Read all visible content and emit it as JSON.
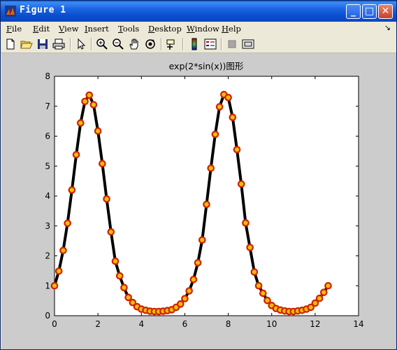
{
  "window": {
    "title": "Figure 1",
    "controls": {
      "minimize": "_",
      "maximize": "□",
      "close": "✕"
    }
  },
  "menubar": {
    "items": [
      {
        "label": "File",
        "accel": "F",
        "rest": "ile"
      },
      {
        "label": "Edit",
        "accel": "E",
        "rest": "dit"
      },
      {
        "label": "View",
        "accel": "V",
        "rest": "iew"
      },
      {
        "label": "Insert",
        "accel": "I",
        "rest": "nsert"
      },
      {
        "label": "Tools",
        "accel": "T",
        "rest": "ools"
      },
      {
        "label": "Desktop",
        "accel": "D",
        "rest": "esktop"
      },
      {
        "label": "Window",
        "accel": "W",
        "rest": "indow"
      },
      {
        "label": "Help",
        "accel": "H",
        "rest": "elp"
      }
    ],
    "overflow_arrow": "↘"
  },
  "toolbar": {
    "icons": [
      "new-figure-icon",
      "open-file-icon",
      "save-icon",
      "print-icon",
      "select-arrow-icon",
      "zoom-in-icon",
      "zoom-out-icon",
      "pan-hand-icon",
      "rotate-3d-icon",
      "data-cursor-icon",
      "colorbar-icon",
      "legend-icon",
      "hide-plot-tools-icon",
      "show-plot-tools-icon"
    ]
  },
  "chart_data": {
    "type": "line",
    "title": "exp(2*sin(x))图形",
    "xlabel": "",
    "ylabel": "",
    "xlim": [
      0,
      14
    ],
    "ylim": [
      0,
      8
    ],
    "xticks": [
      "0",
      "2",
      "4",
      "6",
      "8",
      "10",
      "12",
      "14"
    ],
    "yticks": [
      "0",
      "1",
      "2",
      "3",
      "4",
      "5",
      "6",
      "7",
      "8"
    ],
    "grid": false,
    "series": [
      {
        "line_color": "#000000",
        "marker_edge_color": "#d02000",
        "marker_face_color": "#f0c000",
        "marker": "circle",
        "x": [
          0,
          0.2,
          0.4,
          0.6,
          0.8,
          1.0,
          1.2,
          1.4,
          1.6,
          1.8,
          2.0,
          2.2,
          2.4,
          2.6,
          2.8,
          3.0,
          3.2,
          3.4,
          3.6,
          3.8,
          4.0,
          4.2,
          4.4,
          4.6,
          4.8,
          5.0,
          5.2,
          5.4,
          5.6,
          5.8,
          6.0,
          6.2,
          6.4,
          6.6,
          6.8,
          7.0,
          7.2,
          7.4,
          7.6,
          7.8,
          8.0,
          8.2,
          8.4,
          8.6,
          8.8,
          9.0,
          9.2,
          9.4,
          9.6,
          9.8,
          10.0,
          10.2,
          10.4,
          10.6,
          10.8,
          11.0,
          11.2,
          11.4,
          11.6,
          11.8,
          12.0,
          12.2,
          12.4,
          12.6
        ],
        "y": [
          1.0,
          1.49,
          2.18,
          3.09,
          4.2,
          5.38,
          6.44,
          7.16,
          7.37,
          7.05,
          6.17,
          5.08,
          3.9,
          2.8,
          1.82,
          1.33,
          0.94,
          0.61,
          0.44,
          0.3,
          0.22,
          0.18,
          0.15,
          0.14,
          0.14,
          0.15,
          0.17,
          0.2,
          0.28,
          0.39,
          0.57,
          0.83,
          1.21,
          1.77,
          2.53,
          3.72,
          4.93,
          6.06,
          6.98,
          7.39,
          7.29,
          6.63,
          5.55,
          4.4,
          3.1,
          2.28,
          1.46,
          1.0,
          0.75,
          0.51,
          0.34,
          0.24,
          0.19,
          0.16,
          0.14,
          0.14,
          0.16,
          0.18,
          0.22,
          0.28,
          0.42,
          0.58,
          0.78,
          1.0
        ]
      }
    ]
  }
}
